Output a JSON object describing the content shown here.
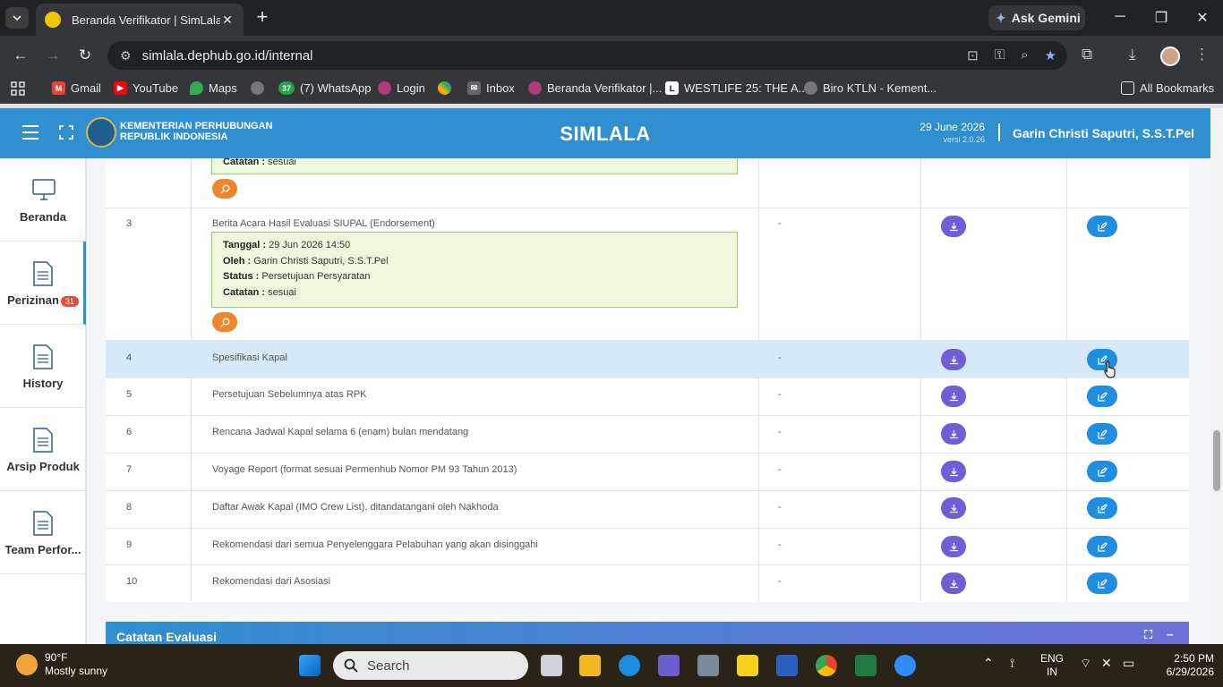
{
  "browser": {
    "tab_title": "Beranda Verifikator | SimLala",
    "ask_gemini": "Ask Gemini",
    "url": "simlala.dephub.go.id/internal",
    "bookmarks": [
      "Gmail",
      "YouTube",
      "Maps",
      "(7) WhatsApp",
      "Login",
      "Inbox",
      "Beranda Verifikator |...",
      "WESTLIFE 25: THE A...",
      "Biro KTLN - Kement..."
    ],
    "whatsapp_count": "37",
    "all_bookmarks": "All Bookmarks"
  },
  "header": {
    "org_line1": "KEMENTERIAN PERHUBUNGAN",
    "org_line2": "REPUBLIK INDONESIA",
    "app_name": "SIMLALA",
    "date": "29 June 2026",
    "version": "versi 2.0.26",
    "user": "Garin Christi Saputri, S.S.T.Pel"
  },
  "sidebar": {
    "items": [
      {
        "label": "Beranda"
      },
      {
        "label": "Perizinan",
        "badge": "31"
      },
      {
        "label": "History"
      },
      {
        "label": "Arsip Produk"
      },
      {
        "label": "Team Perfor..."
      }
    ]
  },
  "table": {
    "partial_top_note": {
      "label": "Catatan :",
      "value": "sesuai"
    },
    "row3": {
      "no": "3",
      "doc": "Berita Acara Hasil Evaluasi SIUPAL (Endorsement)",
      "tanggal_label": "Tanggal :",
      "tanggal": "29 Jun 2026 14:50",
      "oleh_label": "Oleh :",
      "oleh": "Garin Christi Saputri, S.S.T.Pel",
      "status_label": "Status :",
      "status": "Persetujuan Persyaratan",
      "catatan_label": "Catatan :",
      "catatan": "sesuai",
      "dash": "-"
    },
    "rows": [
      {
        "no": "4",
        "doc": "Spesifikasi Kapal",
        "dash": "-"
      },
      {
        "no": "5",
        "doc": "Persetujuan Sebelumnya atas RPK",
        "dash": "-"
      },
      {
        "no": "6",
        "doc": "Rencana Jadwal Kapal selama 6 (enam) bulan mendatang",
        "dash": "-"
      },
      {
        "no": "7",
        "doc": "Voyage Report (format sesuai Permenhub Nomor PM 93 Tahun 2013)",
        "dash": "-"
      },
      {
        "no": "8",
        "doc": "Daftar Awak Kapal (IMO Crew List), ditandatangani oleh Nakhoda",
        "dash": "-"
      },
      {
        "no": "9",
        "doc": "Rekomendasi dari semua Penyelenggara Pelabuhan yang akan disinggahi",
        "dash": "-"
      },
      {
        "no": "10",
        "doc": "Rekomendasi dari Asosiasi",
        "dash": "-"
      }
    ]
  },
  "evaluation": {
    "title": "Catatan Evaluasi"
  },
  "taskbar": {
    "temp": "90°F",
    "weather": "Mostly sunny",
    "search_placeholder": "Search",
    "lang1": "ENG",
    "lang2": "IN",
    "time": "2:50 PM",
    "date": "6/29/2026"
  },
  "colors": {
    "header_blue": "#2f8fcf",
    "download_purple": "#6f5fd6",
    "edit_blue": "#1f8ee0",
    "search_orange": "#f0862b",
    "note_green_border": "#8fd35a"
  }
}
